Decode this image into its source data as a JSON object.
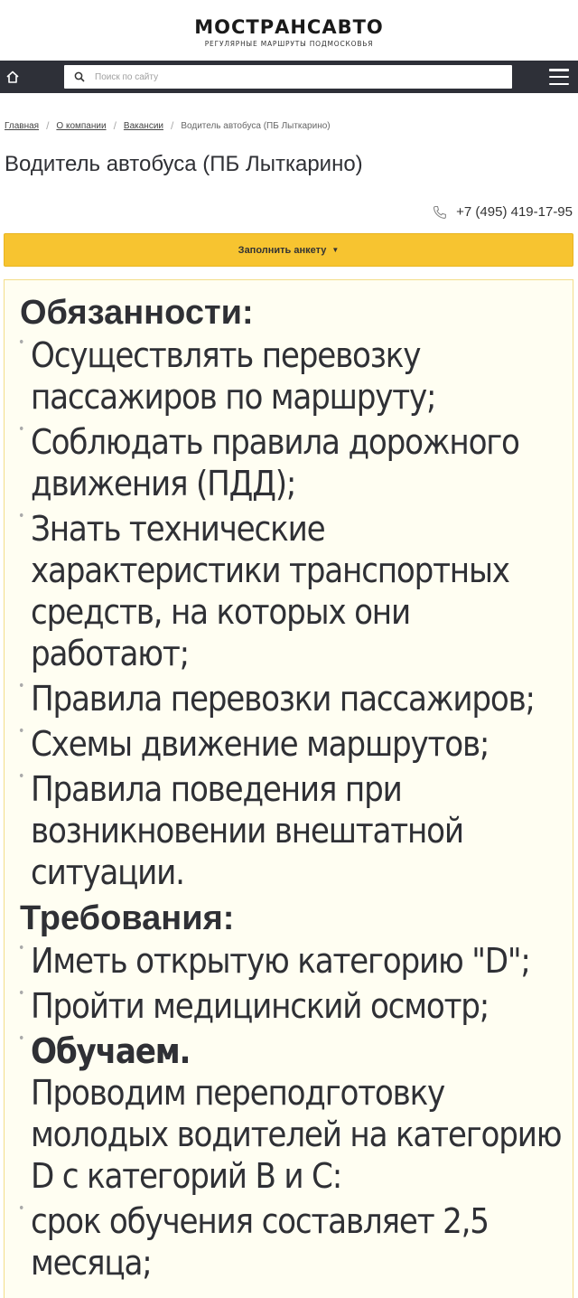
{
  "brand": {
    "logo_text": "МОСТРАНСАВТО",
    "tagline": "РЕГУЛЯРНЫЕ МАРШРУТЫ ПОДМОСКОВЬЯ"
  },
  "navbar": {
    "home_icon": "home-icon",
    "search_placeholder": "Поиск по сайту",
    "menu_icon": "hamburger-icon"
  },
  "breadcrumb": {
    "items": [
      "Главная",
      "О компании",
      "Вакансии"
    ],
    "current": "Водитель автобуса (ПБ Лыткарино)"
  },
  "page": {
    "title": "Водитель автобуса (ПБ Лыткарино)",
    "phone": "+7 (495) 419-17-95",
    "apply_label": "Заполнить анкету"
  },
  "content": {
    "duties_heading": "Обязанности:",
    "duties": [
      "Осуществлять перевозку пассажиров по маршруту;",
      "Соблюдать правила дорожного движения (ПДД);",
      "Знать технические характеристики транспортных средств, на которых они работают;",
      "Правила перевозки пассажиров;",
      "Схемы движение маршрутов;",
      "Правила поведения при возникновении внештатной ситуации."
    ],
    "requirements_heading": "Требования:",
    "requirements": [
      "Иметь открытую категорию \"D\";",
      "Пройти медицинский осмотр;"
    ],
    "training_title": "Обучаем.",
    "training_text": "Проводим переподготовку молодых водителей на категорию D с категорий B и C:",
    "training_term": "срок обучения составляет 2,5 месяца;"
  },
  "colors": {
    "navbar_bg": "#2e3038",
    "accent_yellow": "#f7c430",
    "content_bg": "#fffef2"
  }
}
